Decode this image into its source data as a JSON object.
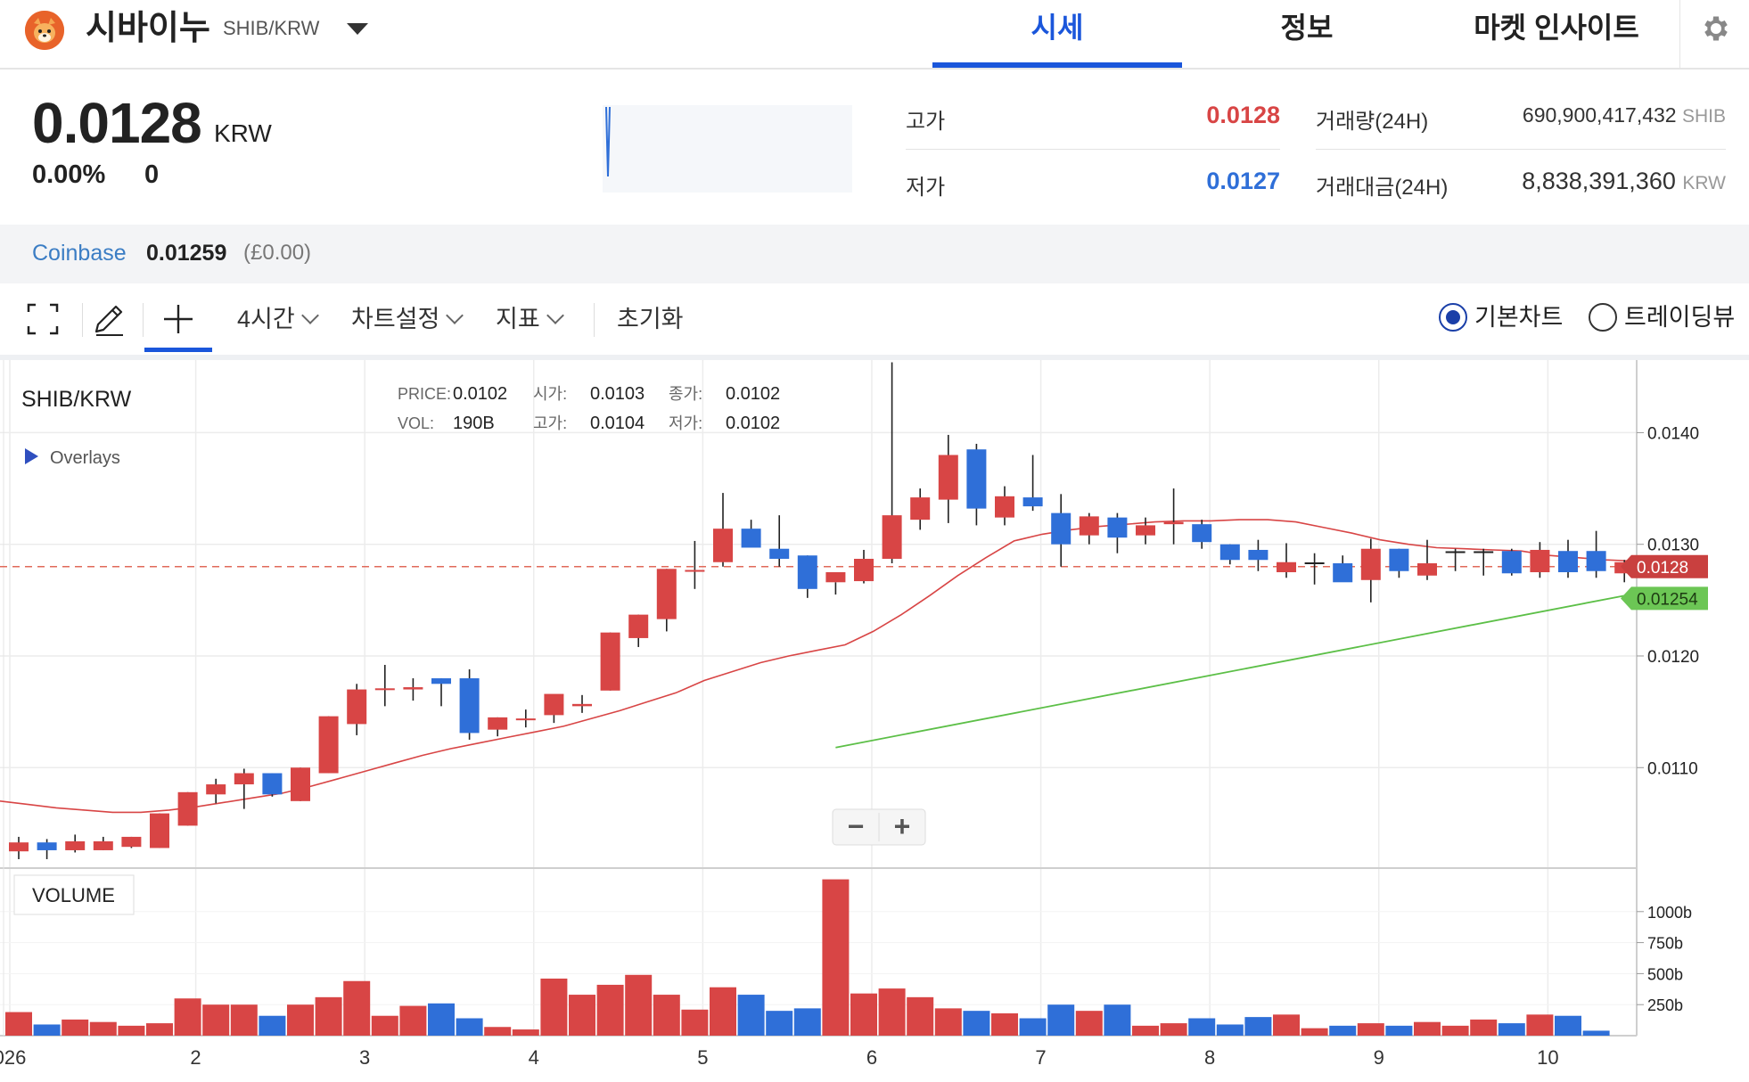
{
  "header": {
    "coin_name": "시바이누",
    "pair": "SHIB/KRW",
    "tabs": [
      {
        "label": "시세",
        "active": true
      },
      {
        "label": "정보",
        "active": false
      },
      {
        "label": "마켓 인사이트",
        "active": false
      }
    ],
    "accent_color": "#1a56db"
  },
  "summary": {
    "price": "0.0128",
    "unit": "KRW",
    "change_pct": "0.00%",
    "change_abs": "0",
    "high_label": "고가",
    "high_value": "0.0128",
    "low_label": "저가",
    "low_value": "0.0127",
    "volume_label": "거래량(24H)",
    "volume_value": "690,900,417,432",
    "volume_unit": "SHIB",
    "amount_label": "거래대금(24H)",
    "amount_value": "8,838,391,360",
    "amount_unit": "KRW",
    "up_color": "#d84545",
    "down_color": "#2f6fd8"
  },
  "exchange": {
    "name": "Coinbase",
    "price": "0.01259",
    "change": "(£0.00)"
  },
  "toolbar": {
    "interval": "4시간",
    "chart_settings": "차트설정",
    "indicators": "지표",
    "reset": "초기화",
    "basic_chart": "기본차트",
    "tradingview": "트레이딩뷰",
    "selected_view": "기본차트"
  },
  "chart": {
    "symbol": "SHIB/KRW",
    "overlays_label": "Overlays",
    "volume_label": "VOLUME",
    "info": {
      "price_label": "PRICE:",
      "price_value": "0.0102",
      "vol_label": "VOL:",
      "vol_value": "190B",
      "open_label": "시가:",
      "open_value": "0.0103",
      "high_label": "고가:",
      "high_value": "0.0104",
      "close_label": "종가:",
      "close_value": "0.0102",
      "low_label": "저가:",
      "low_value": "0.0102"
    },
    "zoom_out": "−",
    "zoom_in": "+",
    "last_price_tag": "0.0128",
    "ma_tag": "0.01254"
  },
  "chart_data": {
    "type": "candlestick",
    "interval": "4h",
    "y_ticks": [
      0.011,
      0.012,
      0.013,
      0.014
    ],
    "y_tick_labels": [
      "0.0110",
      "0.0120",
      "0.0130",
      "0.0140"
    ],
    "ylim": [
      0.0101,
      0.01465
    ],
    "x_tick_labels": [
      "026",
      "2",
      "3",
      "4",
      "5",
      "6",
      "7",
      "8",
      "9",
      "10"
    ],
    "x_tick_index": [
      0,
      6.6,
      12.6,
      18.6,
      24.6,
      30.6,
      36.6,
      42.6,
      48.6,
      54.6
    ],
    "last_price": 0.0128,
    "candles": [
      {
        "o": 0.01025,
        "h": 0.01038,
        "l": 0.01018,
        "c": 0.01033
      },
      {
        "o": 0.01033,
        "h": 0.01036,
        "l": 0.01018,
        "c": 0.01026
      },
      {
        "o": 0.01026,
        "h": 0.0104,
        "l": 0.01024,
        "c": 0.01034
      },
      {
        "o": 0.01026,
        "h": 0.01038,
        "l": 0.01026,
        "c": 0.01034
      },
      {
        "o": 0.01029,
        "h": 0.01038,
        "l": 0.01028,
        "c": 0.01038
      },
      {
        "o": 0.01028,
        "h": 0.01059,
        "l": 0.01028,
        "c": 0.01059
      },
      {
        "o": 0.01048,
        "h": 0.01078,
        "l": 0.01048,
        "c": 0.01078
      },
      {
        "o": 0.01076,
        "h": 0.0109,
        "l": 0.01068,
        "c": 0.01085
      },
      {
        "o": 0.01085,
        "h": 0.01099,
        "l": 0.01063,
        "c": 0.01095
      },
      {
        "o": 0.01095,
        "h": 0.01095,
        "l": 0.01074,
        "c": 0.01076
      },
      {
        "o": 0.0107,
        "h": 0.011,
        "l": 0.0107,
        "c": 0.011
      },
      {
        "o": 0.01095,
        "h": 0.01146,
        "l": 0.01095,
        "c": 0.01146
      },
      {
        "o": 0.01139,
        "h": 0.01175,
        "l": 0.01129,
        "c": 0.0117
      },
      {
        "o": 0.0117,
        "h": 0.01192,
        "l": 0.01155,
        "c": 0.01171
      },
      {
        "o": 0.0117,
        "h": 0.0118,
        "l": 0.0116,
        "c": 0.01172
      },
      {
        "o": 0.0118,
        "h": 0.0118,
        "l": 0.01155,
        "c": 0.01175
      },
      {
        "o": 0.0118,
        "h": 0.01188,
        "l": 0.01125,
        "c": 0.01131
      },
      {
        "o": 0.01134,
        "h": 0.01145,
        "l": 0.01128,
        "c": 0.01145
      },
      {
        "o": 0.01143,
        "h": 0.01152,
        "l": 0.01136,
        "c": 0.01144
      },
      {
        "o": 0.01147,
        "h": 0.01162,
        "l": 0.0114,
        "c": 0.01166
      },
      {
        "o": 0.01155,
        "h": 0.01165,
        "l": 0.01149,
        "c": 0.01157
      },
      {
        "o": 0.01169,
        "h": 0.01221,
        "l": 0.01169,
        "c": 0.01221
      },
      {
        "o": 0.01216,
        "h": 0.01237,
        "l": 0.01208,
        "c": 0.01237
      },
      {
        "o": 0.01233,
        "h": 0.01278,
        "l": 0.01222,
        "c": 0.01278
      },
      {
        "o": 0.01276,
        "h": 0.01303,
        "l": 0.0126,
        "c": 0.01277
      },
      {
        "o": 0.01284,
        "h": 0.01346,
        "l": 0.0128,
        "c": 0.01314
      },
      {
        "o": 0.01314,
        "h": 0.01322,
        "l": 0.013,
        "c": 0.01297
      },
      {
        "o": 0.01296,
        "h": 0.01326,
        "l": 0.0128,
        "c": 0.01287
      },
      {
        "o": 0.0129,
        "h": 0.0129,
        "l": 0.01252,
        "c": 0.0126
      },
      {
        "o": 0.01266,
        "h": 0.01266,
        "l": 0.01255,
        "c": 0.01275
      },
      {
        "o": 0.01267,
        "h": 0.01295,
        "l": 0.01265,
        "c": 0.01287
      },
      {
        "o": 0.01287,
        "h": 0.01463,
        "l": 0.01283,
        "c": 0.01326
      },
      {
        "o": 0.01322,
        "h": 0.0135,
        "l": 0.01313,
        "c": 0.01342
      },
      {
        "o": 0.0134,
        "h": 0.01398,
        "l": 0.01319,
        "c": 0.0138
      },
      {
        "o": 0.01385,
        "h": 0.0139,
        "l": 0.01317,
        "c": 0.01332
      },
      {
        "o": 0.01324,
        "h": 0.01352,
        "l": 0.01317,
        "c": 0.01343
      },
      {
        "o": 0.01342,
        "h": 0.0138,
        "l": 0.0133,
        "c": 0.01334
      },
      {
        "o": 0.01328,
        "h": 0.01345,
        "l": 0.0128,
        "c": 0.013
      },
      {
        "o": 0.01308,
        "h": 0.01328,
        "l": 0.013,
        "c": 0.01325
      },
      {
        "o": 0.01324,
        "h": 0.01328,
        "l": 0.01292,
        "c": 0.01306
      },
      {
        "o": 0.01308,
        "h": 0.01324,
        "l": 0.013,
        "c": 0.01317
      },
      {
        "o": 0.01318,
        "h": 0.0135,
        "l": 0.013,
        "c": 0.0132
      },
      {
        "o": 0.01318,
        "h": 0.01322,
        "l": 0.01296,
        "c": 0.01302
      },
      {
        "o": 0.013,
        "h": 0.013,
        "l": 0.01282,
        "c": 0.01286
      },
      {
        "o": 0.01295,
        "h": 0.01304,
        "l": 0.01276,
        "c": 0.01286
      },
      {
        "o": 0.01275,
        "h": 0.01301,
        "l": 0.0127,
        "c": 0.01284
      },
      {
        "o": 0.01283,
        "h": 0.01292,
        "l": 0.01264,
        "c": 0.01283
      },
      {
        "o": 0.01283,
        "h": 0.0129,
        "l": 0.0127,
        "c": 0.01266
      },
      {
        "o": 0.01268,
        "h": 0.01305,
        "l": 0.01248,
        "c": 0.01296
      },
      {
        "o": 0.01296,
        "h": 0.01296,
        "l": 0.0127,
        "c": 0.01276
      },
      {
        "o": 0.01272,
        "h": 0.01304,
        "l": 0.01268,
        "c": 0.01283
      },
      {
        "o": 0.01293,
        "h": 0.01296,
        "l": 0.01276,
        "c": 0.01293
      },
      {
        "o": 0.01293,
        "h": 0.01296,
        "l": 0.01272,
        "c": 0.01293
      },
      {
        "o": 0.01294,
        "h": 0.01296,
        "l": 0.01272,
        "c": 0.01274
      },
      {
        "o": 0.01275,
        "h": 0.01302,
        "l": 0.0127,
        "c": 0.01295
      },
      {
        "o": 0.01294,
        "h": 0.01304,
        "l": 0.0127,
        "c": 0.01275
      },
      {
        "o": 0.01294,
        "h": 0.01312,
        "l": 0.0127,
        "c": 0.01276
      },
      {
        "o": 0.01274,
        "h": 0.01286,
        "l": 0.01266,
        "c": 0.01284
      },
      {
        "o": 0.01282,
        "h": 0.01286,
        "l": 0.01272,
        "c": 0.01282
      }
    ],
    "ma_red": [
      0.0107,
      0.01067,
      0.01064,
      0.01062,
      0.0106,
      0.0106,
      0.01062,
      0.01065,
      0.01069,
      0.01073,
      0.01077,
      0.01083,
      0.0109,
      0.01097,
      0.01104,
      0.01111,
      0.01117,
      0.01122,
      0.01127,
      0.01132,
      0.01137,
      0.01144,
      0.01151,
      0.01159,
      0.01167,
      0.01178,
      0.01186,
      0.01194,
      0.012,
      0.01205,
      0.0121,
      0.01222,
      0.01237,
      0.01254,
      0.01272,
      0.01288,
      0.01303,
      0.01309,
      0.01313,
      0.01316,
      0.01318,
      0.0132,
      0.01321,
      0.01321,
      0.01322,
      0.01322,
      0.0132,
      0.01315,
      0.0131,
      0.01304,
      0.013,
      0.01297,
      0.01296,
      0.01295,
      0.01294,
      0.0129,
      0.01288,
      0.01286,
      0.01285
    ],
    "ma_green_start_index": 29,
    "ma_green_end_index": 57,
    "ma_green_start": 0.01118,
    "ma_green_end": 0.01254,
    "volume_ticks": [
      250,
      500,
      750,
      1000
    ],
    "volume_tick_labels": [
      "250b",
      "500b",
      "750b",
      "1000b"
    ],
    "volume_max": 1250,
    "volumes": [
      190,
      90,
      130,
      110,
      80,
      100,
      300,
      250,
      250,
      160,
      250,
      310,
      440,
      160,
      240,
      260,
      140,
      70,
      50,
      460,
      330,
      410,
      490,
      330,
      210,
      390,
      330,
      200,
      220,
      1260,
      340,
      380,
      310,
      220,
      200,
      180,
      140,
      250,
      200,
      250,
      80,
      100,
      140,
      90,
      150,
      170,
      60,
      80,
      100,
      80,
      110,
      80,
      130,
      100,
      170,
      160,
      40
    ]
  }
}
